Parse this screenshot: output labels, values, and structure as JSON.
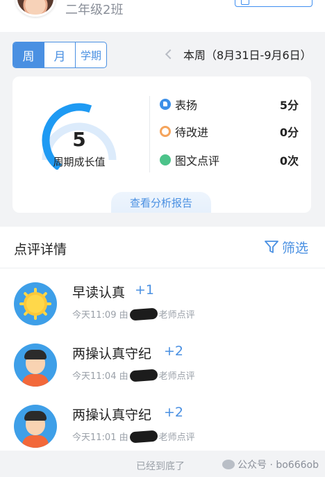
{
  "header": {
    "class_name": "二年级2班"
  },
  "period": {
    "tabs": [
      "周",
      "月",
      "学期"
    ],
    "active_index": 0,
    "range_label": "本周（8月31日-9月6日）"
  },
  "summary": {
    "growth_value": "5",
    "growth_label": "周期成长值",
    "gauge_fraction": 0.65,
    "stats": [
      {
        "label": "表扬",
        "value": "5分",
        "icon": "thumbs-up-icon",
        "color": "#3b8fe8"
      },
      {
        "label": "待改进",
        "value": "0分",
        "icon": "ring-icon",
        "color": "#f5a45c"
      },
      {
        "label": "图文点评",
        "value": "0次",
        "icon": "dot-icon",
        "color": "#4cc38a"
      }
    ],
    "report_link": "查看分析报告"
  },
  "details": {
    "title": "点评详情",
    "filter_label": "筛选",
    "items": [
      {
        "title": "早读认真",
        "points": "+1",
        "time": "今天11:09 由",
        "suffix": "老师点评",
        "avatar": "sun-avatar"
      },
      {
        "title": "两操认真守纪",
        "points": "+2",
        "time": "今天11:04 由",
        "suffix": "老师点评",
        "avatar": "kid-avatar"
      },
      {
        "title": "两操认真守纪",
        "points": "+2",
        "time": "今天11:01 由",
        "suffix": "老师点评",
        "avatar": "kid-avatar"
      }
    ]
  },
  "footer": {
    "end_text": "已经到底了",
    "watermark": "公众号 · bo666ob"
  },
  "colors": {
    "accent": "#4a90e2",
    "gauge_fill": "#1e9af3",
    "gauge_track": "#dcebfb"
  }
}
